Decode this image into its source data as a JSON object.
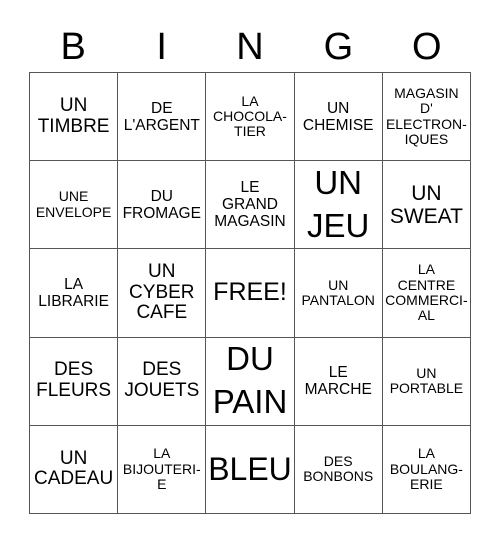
{
  "title_letters": [
    "B",
    "I",
    "N",
    "G",
    "O"
  ],
  "cells": [
    {
      "text": "UN\nTIMBRE",
      "size": "s18"
    },
    {
      "text": "DE\nL'ARGENT",
      "size": "s15"
    },
    {
      "text": "LA\nCHOCOLA-\nTIER",
      "size": "s13"
    },
    {
      "text": "UN\nCHEMISE",
      "size": "s15"
    },
    {
      "text": "MAGASIN\nD'\nELECTRON-\nIQUES",
      "size": "s13"
    },
    {
      "text": "UNE\nENVELOPE",
      "size": "s13"
    },
    {
      "text": "DU\nFROMAGE",
      "size": "s15"
    },
    {
      "text": "LE\nGRAND\nMAGASIN",
      "size": "s15"
    },
    {
      "text": "UN\nJEU",
      "size": "s32"
    },
    {
      "text": "UN\nSWEAT",
      "size": "s20"
    },
    {
      "text": "LA\nLIBRARIE",
      "size": "s15"
    },
    {
      "text": "UN\nCYBER\nCAFE",
      "size": "s18"
    },
    {
      "text": "FREE!",
      "size": "s24"
    },
    {
      "text": "UN\nPANTALON",
      "size": "s13"
    },
    {
      "text": "LA\nCENTRE\nCOMMERCI-\nAL",
      "size": "s13"
    },
    {
      "text": "DES\nFLEURS",
      "size": "s18"
    },
    {
      "text": "DES\nJOUETS",
      "size": "s18"
    },
    {
      "text": "DU\nPAIN",
      "size": "s32"
    },
    {
      "text": "LE\nMARCHE",
      "size": "s15"
    },
    {
      "text": "UN\nPORTABLE",
      "size": "s13"
    },
    {
      "text": "UN\nCADEAU",
      "size": "s18"
    },
    {
      "text": "LA\nBIJOUTERI-\nE",
      "size": "s13"
    },
    {
      "text": "BLEU",
      "size": "s30"
    },
    {
      "text": "DES\nBONBONS",
      "size": "s13"
    },
    {
      "text": "LA\nBOULANG-\nERIE",
      "size": "s13"
    }
  ]
}
